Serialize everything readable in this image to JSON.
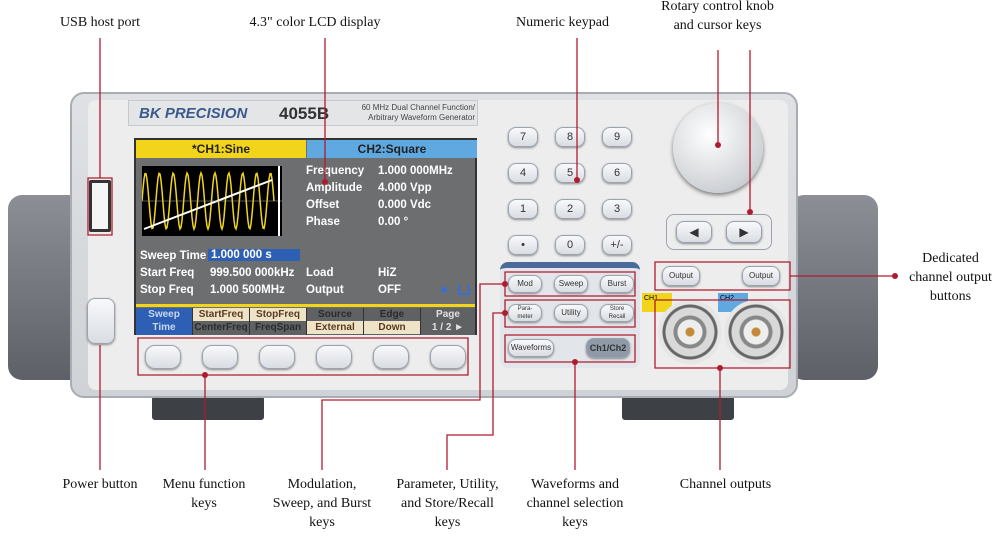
{
  "callouts": {
    "usb": "USB host port",
    "lcd": "4.3\" color LCD display",
    "keypad": "Numeric keypad",
    "rotary": "Rotary control knob\nand cursor keys",
    "output_buttons": "Dedicated\nchannel output\nbuttons",
    "power": "Power button",
    "menu": "Menu function\nkeys",
    "modulation": "Modulation,\nSweep, and Burst\nkeys",
    "parameter": "Parameter, Utility,\nand Store/Recall\nkeys",
    "waveforms": "Waveforms and\nchannel selection\nkeys",
    "channels": "Channel outputs"
  },
  "device": {
    "brand": "BK PRECISION",
    "model": "4055B",
    "description": "60 MHz Dual Channel Function/\nArbitrary Waveform Generator"
  },
  "lcd": {
    "tab1": "*CH1:Sine",
    "tab2": "CH2:Square",
    "params": [
      {
        "label": "Frequency",
        "value": "1.000 000MHz"
      },
      {
        "label": "Amplitude",
        "value": "4.000 Vpp"
      },
      {
        "label": "Offset",
        "value": "0.000 Vdc"
      },
      {
        "label": "Phase",
        "value": "0.00 °"
      }
    ],
    "sweep_time_label": "Sweep Time",
    "sweep_time_value": "1.000 000 s",
    "start_freq_label": "Start Freq",
    "start_freq_value": "999.500 000kHz",
    "stop_freq_label": "Stop Freq",
    "stop_freq_value": "1.000 500MHz",
    "load_label": "Load",
    "load_value": "HiZ",
    "output_label": "Output",
    "output_value": "OFF",
    "softkeys": [
      {
        "top": "Sweep",
        "bottom": "Time"
      },
      {
        "top": "StartFreq",
        "bottom": "CenterFreq"
      },
      {
        "top": "StopFreq",
        "bottom": "FreqSpan"
      },
      {
        "top": "Source",
        "bottom": "External"
      },
      {
        "top": "Edge",
        "bottom": "Down"
      },
      {
        "top": "Page",
        "bottom": "1 / 2 ►"
      }
    ]
  },
  "keypad": [
    "7",
    "8",
    "9",
    "4",
    "5",
    "6",
    "1",
    "2",
    "3",
    "•",
    "0",
    "+/-"
  ],
  "function_keys": [
    "Mod",
    "Sweep",
    "Burst",
    "Para-\nmeter",
    "Utility",
    "Store\nRecall"
  ],
  "waveforms_key": "Waveforms",
  "channel_key": "Ch1/Ch2",
  "output_key": "Output",
  "ch1_label": "CH1",
  "ch2_label": "CH2",
  "colors": {
    "callout": "#b01c2e",
    "ch1": "#f2d51b",
    "ch2": "#5fa8e0",
    "lcd_bg": "#6c6e70"
  }
}
